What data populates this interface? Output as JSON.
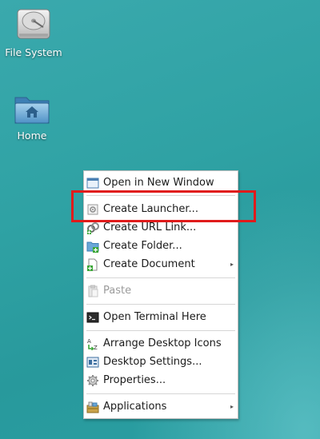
{
  "desktop": {
    "icons": [
      {
        "label": "File System",
        "icon": "hard-drive-icon"
      },
      {
        "label": "Home",
        "icon": "home-folder-icon"
      }
    ]
  },
  "context_menu": {
    "items": [
      {
        "label": "Open in New Window",
        "icon": "folder-window-icon",
        "enabled": true
      },
      {
        "label": "Create Launcher...",
        "icon": "launcher-icon",
        "enabled": true
      },
      {
        "label": "Create URL Link...",
        "icon": "url-link-icon",
        "enabled": true
      },
      {
        "label": "Create Folder...",
        "icon": "new-folder-icon",
        "enabled": true
      },
      {
        "label": "Create Document",
        "icon": "new-document-icon",
        "enabled": true,
        "submenu": true
      },
      {
        "label": "Paste",
        "icon": "paste-icon",
        "enabled": false
      },
      {
        "label": "Open Terminal Here",
        "icon": "terminal-icon",
        "enabled": true
      },
      {
        "label": "Arrange Desktop Icons",
        "icon": "sort-az-icon",
        "enabled": true
      },
      {
        "label": "Desktop Settings...",
        "icon": "desktop-settings-icon",
        "enabled": true
      },
      {
        "label": "Properties...",
        "icon": "gear-icon",
        "enabled": true
      },
      {
        "label": "Applications",
        "icon": "applications-icon",
        "enabled": true,
        "submenu": true
      }
    ],
    "submenu_arrow": "▸"
  },
  "colors": {
    "desktop_bg": "#2fa2a4",
    "highlight": "#e01b1b"
  }
}
